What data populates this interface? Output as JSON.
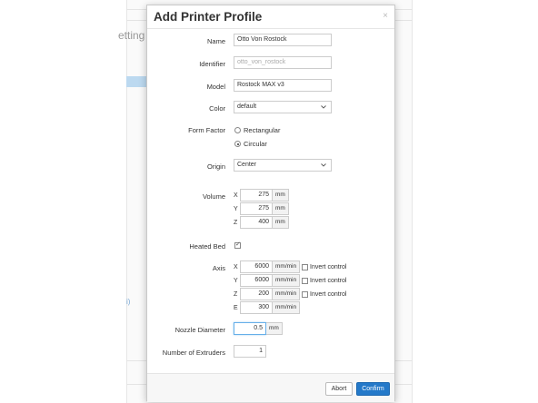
{
  "background": {
    "title_fragment": "etting",
    "link_fragment": "i)"
  },
  "modal": {
    "title": "Add Printer Profile",
    "close": "×"
  },
  "form": {
    "name": {
      "label": "Name",
      "value": "Otto Von Rostock"
    },
    "identifier": {
      "label": "Identifier",
      "placeholder": "otto_von_rostock"
    },
    "model": {
      "label": "Model",
      "value": "Rostock MAX v3"
    },
    "color": {
      "label": "Color",
      "value": "default"
    },
    "form_factor": {
      "label": "Form Factor",
      "options": [
        "Rectangular",
        "Circular"
      ],
      "selected": "Circular"
    },
    "origin": {
      "label": "Origin",
      "value": "Center"
    },
    "volume": {
      "label": "Volume",
      "rows": [
        {
          "axis": "X",
          "value": "275",
          "unit": "mm"
        },
        {
          "axis": "Y",
          "value": "275",
          "unit": "mm"
        },
        {
          "axis": "Z",
          "value": "400",
          "unit": "mm"
        }
      ]
    },
    "heated_bed": {
      "label": "Heated Bed",
      "checked": true
    },
    "axes": {
      "label": "Axis",
      "invert_label": "Invert control",
      "rows": [
        {
          "axis": "X",
          "value": "6000",
          "unit": "mm/min"
        },
        {
          "axis": "Y",
          "value": "6000",
          "unit": "mm/min"
        },
        {
          "axis": "Z",
          "value": "200",
          "unit": "mm/min"
        },
        {
          "axis": "E",
          "value": "300",
          "unit": "mm/min"
        }
      ]
    },
    "nozzle": {
      "label": "Nozzle Diameter",
      "value": "0.5",
      "unit": "mm"
    },
    "extruders": {
      "label": "Number of Extruders",
      "value": "1"
    }
  },
  "footer": {
    "abort": "Abort",
    "confirm": "Confirm"
  },
  "colors": {
    "primary": "#2479c9",
    "highlight_bar": "#bcd9f0"
  }
}
